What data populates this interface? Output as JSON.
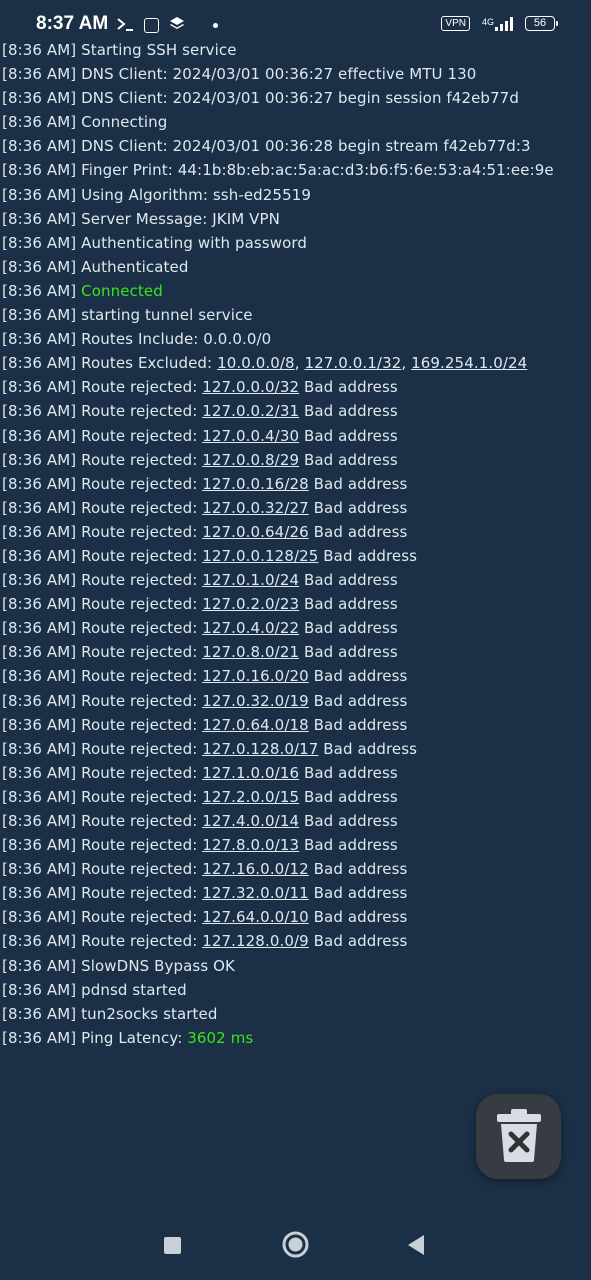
{
  "status_bar": {
    "time": "8:37 AM",
    "left_icons": [
      "terminal-icon",
      "app-notification-icon",
      "layers-icon",
      "dot-icon"
    ],
    "vpn_label": "VPN",
    "network_type": "4G",
    "battery_level": "56"
  },
  "log_prefix": "[8:36 AM]",
  "log": [
    {
      "text": "Starting SSH service"
    },
    {
      "text": "DNS Client: 2024/03/01 00:36:27 effective MTU 130"
    },
    {
      "text": "DNS Client: 2024/03/01 00:36:27 begin session f42eb77d"
    },
    {
      "text": "Connecting"
    },
    {
      "text": "DNS Client: 2024/03/01 00:36:28 begin stream f42eb77d:3",
      "wrap": true
    },
    {
      "text": "Finger Print: 44:1b:8b:eb:ac:5a:ac:d3:b6:f5:6e:53:a4:51:ee:9e"
    },
    {
      "text": "Using Algorithm: ssh-ed25519"
    },
    {
      "text": "Server Message: JKIM VPN"
    },
    {
      "text": "Authenticating with password"
    },
    {
      "text": "Authenticated"
    },
    {
      "highlight": "Connected"
    },
    {
      "text": "starting tunnel service"
    },
    {
      "text": "Routes Include: 0.0.0.0/0"
    },
    {
      "text": "Routes Excluded: ",
      "links": [
        "10.0.0.0/8",
        "127.0.0.1/32",
        "169.254.1.0/24"
      ]
    },
    {
      "text": "Route rejected: ",
      "link": "127.0.0.0/32",
      "suffix": " Bad address"
    },
    {
      "text": "Route rejected: ",
      "link": "127.0.0.2/31",
      "suffix": " Bad address"
    },
    {
      "text": "Route rejected: ",
      "link": "127.0.0.4/30",
      "suffix": " Bad address"
    },
    {
      "text": "Route rejected: ",
      "link": "127.0.0.8/29",
      "suffix": " Bad address"
    },
    {
      "text": "Route rejected: ",
      "link": "127.0.0.16/28",
      "suffix": " Bad address"
    },
    {
      "text": "Route rejected: ",
      "link": "127.0.0.32/27",
      "suffix": " Bad address"
    },
    {
      "text": "Route rejected: ",
      "link": "127.0.0.64/26",
      "suffix": " Bad address"
    },
    {
      "text": "Route rejected: ",
      "link": "127.0.0.128/25",
      "suffix": " Bad address"
    },
    {
      "text": "Route rejected: ",
      "link": "127.0.1.0/24",
      "suffix": " Bad address"
    },
    {
      "text": "Route rejected: ",
      "link": "127.0.2.0/23",
      "suffix": " Bad address"
    },
    {
      "text": "Route rejected: ",
      "link": "127.0.4.0/22",
      "suffix": " Bad address"
    },
    {
      "text": "Route rejected: ",
      "link": "127.0.8.0/21",
      "suffix": " Bad address"
    },
    {
      "text": "Route rejected: ",
      "link": "127.0.16.0/20",
      "suffix": " Bad address"
    },
    {
      "text": "Route rejected: ",
      "link": "127.0.32.0/19",
      "suffix": " Bad address"
    },
    {
      "text": "Route rejected: ",
      "link": "127.0.64.0/18",
      "suffix": " Bad address"
    },
    {
      "text": "Route rejected: ",
      "link": "127.0.128.0/17",
      "suffix": " Bad address"
    },
    {
      "text": "Route rejected: ",
      "link": "127.1.0.0/16",
      "suffix": " Bad address"
    },
    {
      "text": "Route rejected: ",
      "link": "127.2.0.0/15",
      "suffix": " Bad address"
    },
    {
      "text": "Route rejected: ",
      "link": "127.4.0.0/14",
      "suffix": " Bad address"
    },
    {
      "text": "Route rejected: ",
      "link": "127.8.0.0/13",
      "suffix": " Bad address"
    },
    {
      "text": "Route rejected: ",
      "link": "127.16.0.0/12",
      "suffix": " Bad address"
    },
    {
      "text": "Route rejected: ",
      "link": "127.32.0.0/11",
      "suffix": " Bad address"
    },
    {
      "text": "Route rejected: ",
      "link": "127.64.0.0/10",
      "suffix": " Bad address"
    },
    {
      "text": "Route rejected: ",
      "link": "127.128.0.0/9",
      "suffix": " Bad address"
    },
    {
      "text": "SlowDNS Bypass OK"
    },
    {
      "text": "pdnsd started"
    },
    {
      "text": "tun2socks started"
    },
    {
      "text": "Ping Latency: ",
      "highlight": "3602 ms"
    }
  ],
  "fab": {
    "icon": "trash-clear-icon"
  },
  "nav": {
    "icons": [
      "recents-square-icon",
      "home-circle-icon",
      "back-triangle-icon"
    ]
  },
  "colors": {
    "background": "#1b3046",
    "text": "#dfe7ef",
    "highlight": "#39e61a",
    "fab": "#373c42"
  }
}
